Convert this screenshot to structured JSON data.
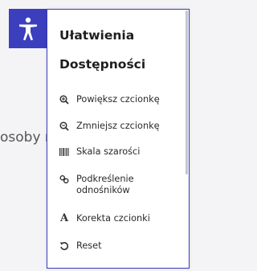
{
  "page": {
    "background_text": "osoby n"
  },
  "toggle": {
    "icon": "accessibility-person-icon",
    "bg_color": "#3b3fbd"
  },
  "panel": {
    "title": "Ułatwienia Dostępności",
    "border_color": "#3b3fbd",
    "items": [
      {
        "label": "Powiększ czcionkę",
        "icon": "zoom-in-icon"
      },
      {
        "label": "Zmniejsz czcionkę",
        "icon": "zoom-out-icon"
      },
      {
        "label": "Skala szarości",
        "icon": "grayscale-icon"
      },
      {
        "label": "Podkreślenie odnośników",
        "icon": "link-icon"
      },
      {
        "label": "Korekta czcionki",
        "icon": "font-icon"
      },
      {
        "label": "Reset",
        "icon": "reset-icon"
      }
    ]
  }
}
